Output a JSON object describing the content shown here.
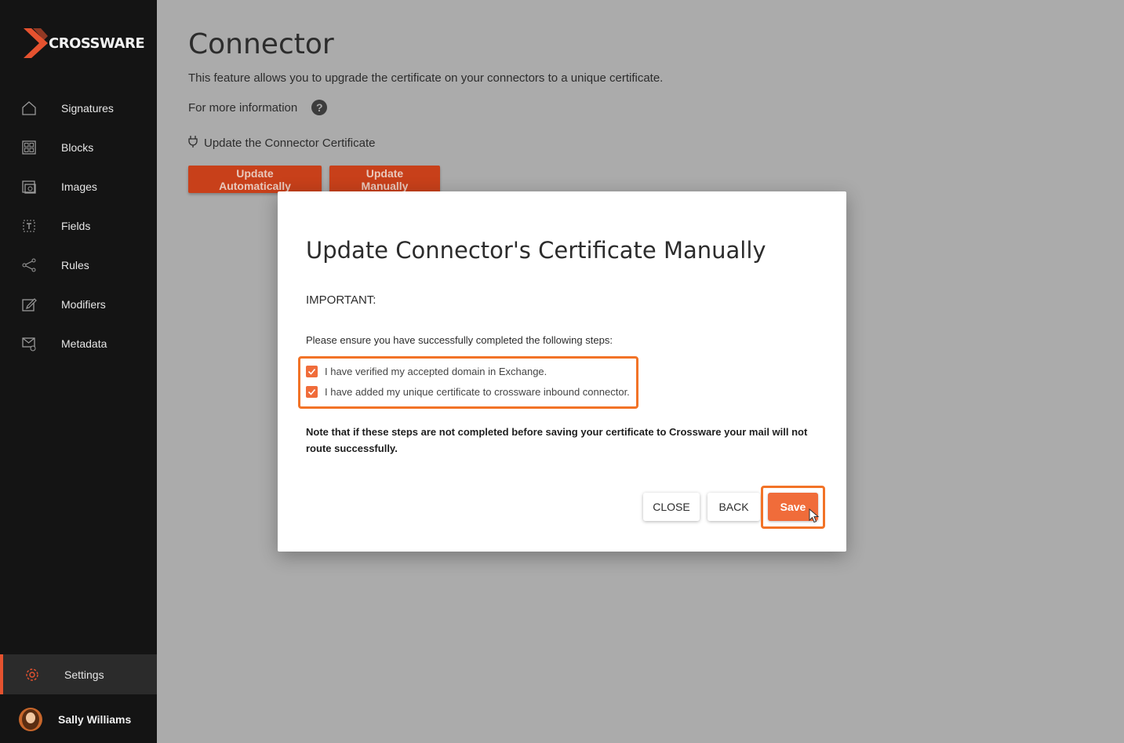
{
  "brand": {
    "name": "CROSSWARE",
    "accent": "#e5522f"
  },
  "sidebar": {
    "items": [
      {
        "label": "Signatures",
        "icon": "home-icon"
      },
      {
        "label": "Blocks",
        "icon": "blocks-icon"
      },
      {
        "label": "Images",
        "icon": "images-icon"
      },
      {
        "label": "Fields",
        "icon": "fields-icon"
      },
      {
        "label": "Rules",
        "icon": "rules-icon"
      },
      {
        "label": "Modifiers",
        "icon": "modifiers-icon"
      },
      {
        "label": "Metadata",
        "icon": "metadata-icon"
      }
    ],
    "settings": {
      "label": "Settings",
      "icon": "gear-icon"
    },
    "user": {
      "name": "Sally Williams"
    }
  },
  "main": {
    "title": "Connector",
    "description": "This feature allows you to upgrade the certificate on your connectors to a unique certificate.",
    "more_info": "For more information",
    "section_label": "Update the Connector Certificate",
    "buttons": {
      "auto": "Update Automatically",
      "manual": "Update Manually"
    }
  },
  "modal": {
    "title": "Update Connector's Certificate Manually",
    "important": "IMPORTANT:",
    "ensure": "Please ensure you have successfully completed the following steps:",
    "checks": [
      {
        "label": "I have verified my accepted domain in Exchange.",
        "checked": true
      },
      {
        "label": "I have added my unique certificate to crossware inbound connector.",
        "checked": true
      }
    ],
    "note": "Note that if these steps are not completed before saving your certificate to Crossware your mail will not route successfully.",
    "close_label": "CLOSE",
    "back_label": "BACK",
    "save_label": "Save"
  }
}
